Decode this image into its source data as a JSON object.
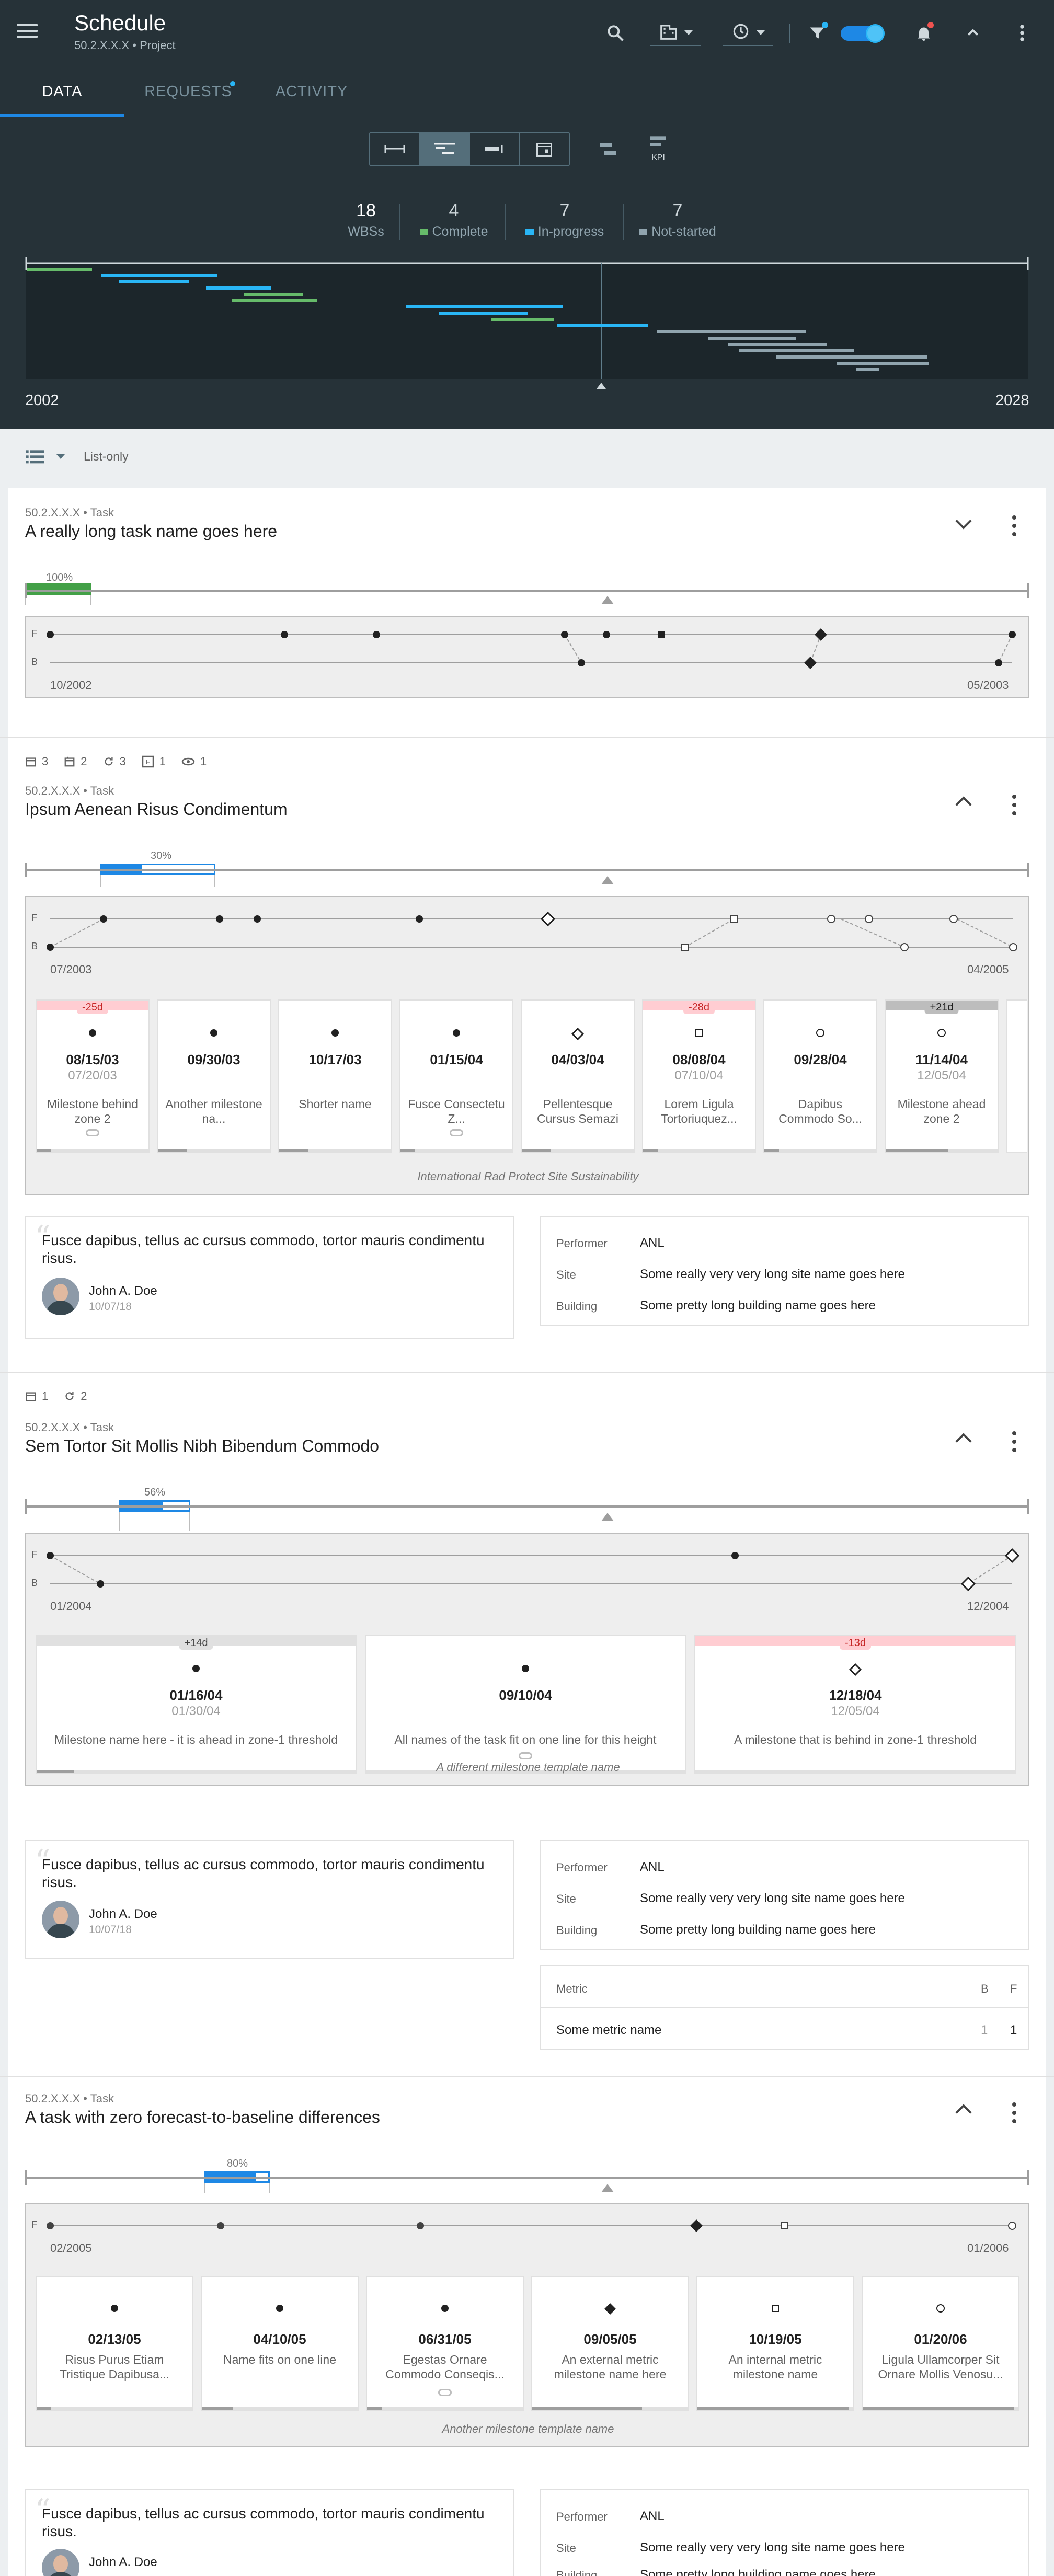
{
  "app": {
    "title": "Schedule",
    "subtitle": "50.2.X.X.X • Project"
  },
  "tabs": [
    {
      "label": "DATA"
    },
    {
      "label": "REQUESTS"
    },
    {
      "label": "ACTIVITY"
    }
  ],
  "summary": {
    "wbs_count": "18",
    "wbs_label": "WBSs",
    "complete_count": "4",
    "complete_label": "Complete",
    "inprogress_count": "7",
    "inprogress_label": "In-progress",
    "notstarted_count": "7",
    "notstarted_label": "Not-started",
    "year_start": "2002",
    "year_end": "2028",
    "colors": {
      "complete": "#66bb6a",
      "inprogress": "#29b6f6",
      "notstarted": "#90a4ae"
    }
  },
  "segment_kpi_label": "KPI",
  "view": {
    "mode_label": "List-only"
  },
  "tasks": [
    {
      "crumb": "50.2.X.X.X • Task",
      "title": "A really long task name goes here",
      "progress_pct": 100,
      "progress_label": "100%",
      "f_label": "F",
      "b_label": "B",
      "start_date": "10/2002",
      "end_date": "05/2003"
    },
    {
      "counts": [
        "3",
        "2",
        "3",
        "1",
        "1"
      ],
      "crumb": "50.2.X.X.X • Task",
      "title": "Ipsum Aenean Risus Condimentum",
      "progress_pct": 30,
      "progress_label": "30%",
      "f_label": "F",
      "b_label": "B",
      "start_date": "07/2003",
      "end_date": "04/2005",
      "milestones": [
        {
          "delta": "-25d",
          "date": "08/15/03",
          "baseline": "07/20/03",
          "name": "Milestone behind zone 2"
        },
        {
          "delta": "",
          "date": "09/30/03",
          "baseline": "",
          "name": "Another milestone na..."
        },
        {
          "delta": "",
          "date": "10/17/03",
          "baseline": "",
          "name": "Shorter name"
        },
        {
          "delta": "",
          "date": "01/15/04",
          "baseline": "",
          "name": "Fusce Consectetu Z..."
        },
        {
          "delta": "",
          "date": "04/03/04",
          "baseline": "",
          "name": "Pellentesque Cursus Semazi"
        },
        {
          "delta": "-28d",
          "date": "08/08/04",
          "baseline": "07/10/04",
          "name": "Lorem Ligula Tortoriuquez..."
        },
        {
          "delta": "",
          "date": "09/28/04",
          "baseline": "",
          "name": "Dapibus Commodo So..."
        },
        {
          "delta": "+21d",
          "date": "11/14/04",
          "baseline": "12/05/04",
          "name": "Milestone ahead zone 2"
        }
      ],
      "template": "International Rad Protect Site Sustainability",
      "comment": {
        "text": "Fusce dapibus, tellus ac cursus commodo, tortor mauris condimentu risus.",
        "author": "John A. Doe",
        "date": "10/07/18"
      },
      "info": {
        "performer_label": "Performer",
        "performer": "ANL",
        "site_label": "Site",
        "site": "Some really very very long site name goes here",
        "building_label": "Building",
        "building": "Some pretty long building name goes here"
      }
    },
    {
      "counts": [
        "1",
        "2"
      ],
      "crumb": "50.2.X.X.X • Task",
      "title": "Sem Tortor Sit Mollis Nibh Bibendum Commodo",
      "progress_pct": 56,
      "progress_label": "56%",
      "f_label": "F",
      "b_label": "B",
      "start_date": "01/2004",
      "end_date": "12/2004",
      "milestones": [
        {
          "delta": "+14d",
          "date": "01/16/04",
          "baseline": "01/30/04",
          "name": "Milestone name here - it is ahead in zone-1 threshold"
        },
        {
          "delta": "",
          "date": "09/10/04",
          "baseline": "",
          "name": "All names of the task fit on one line for this height"
        },
        {
          "delta": "-13d",
          "date": "12/18/04",
          "baseline": "12/05/04",
          "name": "A milestone that is behind in zone-1 threshold"
        }
      ],
      "template": "A different milestone template name",
      "comment": {
        "text": "Fusce dapibus, tellus ac cursus commodo, tortor mauris condimentu risus.",
        "author": "John A. Doe",
        "date": "10/07/18"
      },
      "info": {
        "performer_label": "Performer",
        "performer": "ANL",
        "site_label": "Site",
        "site": "Some really very very long site name goes here",
        "building_label": "Building",
        "building": "Some pretty long building name goes here"
      },
      "metric": {
        "header": "Metric",
        "b": "B",
        "f": "F",
        "name": "Some metric name",
        "b_val": "1",
        "f_val": "1"
      }
    },
    {
      "crumb": "50.2.X.X.X • Task",
      "title": "A task with zero forecast-to-baseline differences",
      "progress_pct": 80,
      "progress_label": "80%",
      "f_label": "F",
      "start_date": "02/2005",
      "end_date": "01/2006",
      "milestones": [
        {
          "date": "02/13/05",
          "name": "Risus Purus Etiam Tristique Dapibusa..."
        },
        {
          "date": "04/10/05",
          "name": "Name fits on one line"
        },
        {
          "date": "06/31/05",
          "name": "Egestas Ornare Commodo Conseqis..."
        },
        {
          "date": "09/05/05",
          "name": "An external metric milestone name here"
        },
        {
          "date": "10/19/05",
          "name": "An internal metric milestone name"
        },
        {
          "date": "01/20/06",
          "name": "Ligula Ullamcorper Sit Ornare Mollis Venosu..."
        }
      ],
      "template": "Another milestone template name",
      "comment": {
        "text": "Fusce dapibus, tellus ac cursus commodo, tortor mauris condimentu risus.",
        "author": "John A. Doe"
      },
      "info": {
        "performer_label": "Performer",
        "performer": "ANL",
        "site_label": "Site",
        "site": "Some really very very long site name goes here",
        "building_label": "Building",
        "building": "Some pretty long building name goes here"
      }
    }
  ]
}
